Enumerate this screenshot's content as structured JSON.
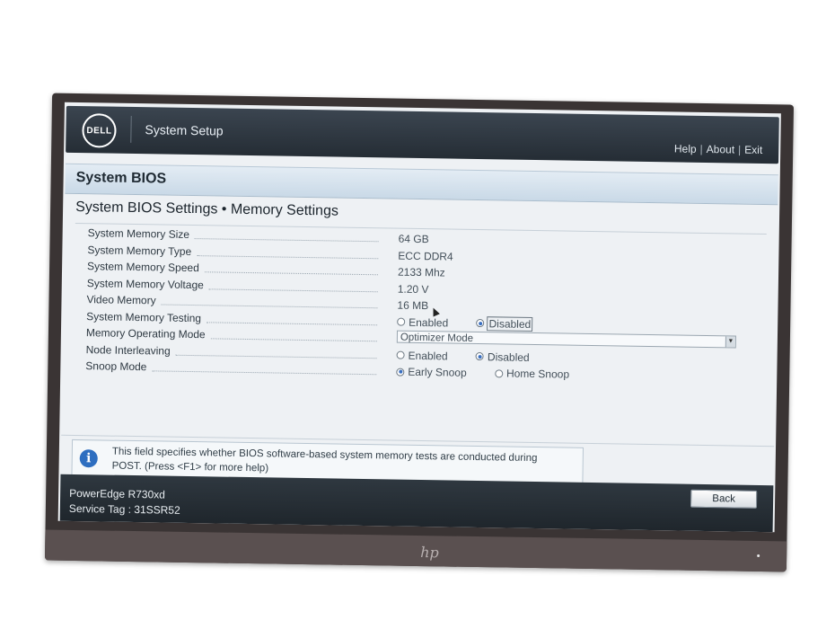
{
  "topbar": {
    "brand": "DELL",
    "title": "System Setup",
    "links": [
      "Help",
      "About",
      "Exit"
    ]
  },
  "section": {
    "title": "System BIOS"
  },
  "page": {
    "title": "System BIOS Settings • Memory Settings"
  },
  "settings": [
    {
      "label": "System Memory Size",
      "value": "64 GB"
    },
    {
      "label": "System Memory Type",
      "value": "ECC DDR4"
    },
    {
      "label": "System Memory Speed",
      "value": "2133 Mhz"
    },
    {
      "label": "System Memory Voltage",
      "value": "1.20 V"
    },
    {
      "label": "Video Memory",
      "value": "16 MB"
    },
    {
      "label": "System Memory Testing",
      "options": [
        "Enabled",
        "Disabled"
      ],
      "selected": "Disabled"
    },
    {
      "label": "Memory Operating Mode",
      "select_value": "Optimizer Mode"
    },
    {
      "label": "Node Interleaving",
      "options": [
        "Enabled",
        "Disabled"
      ],
      "selected": "Disabled"
    },
    {
      "label": "Snoop Mode",
      "options": [
        "Early Snoop",
        "Home Snoop"
      ],
      "selected": "Early Snoop"
    }
  ],
  "help": {
    "icon": "info-icon",
    "text": "This field specifies whether BIOS software-based system memory tests are conducted during POST. (Press <F1> for more help)"
  },
  "footer": {
    "model": "PowerEdge R730xd",
    "service_tag": "Service Tag : 31SSR52",
    "back_label": "Back"
  },
  "monitor": {
    "logo": "hp"
  },
  "colors": {
    "topbar": "#252d35",
    "section_header": "#c9d9e7",
    "radio_selected": "#3a6fc0",
    "info_icon": "#2d6ec0"
  }
}
